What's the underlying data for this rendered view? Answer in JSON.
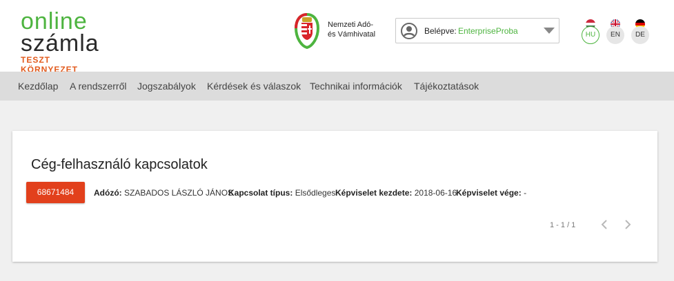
{
  "header": {
    "logo": {
      "line1": "online",
      "line2": "számla",
      "tagline": "TESZT KÖRNYEZET"
    },
    "nav_logo": {
      "line1": "Nemzeti Adó-",
      "line2": "és Vámhivatal"
    },
    "login": {
      "label": "Belépve:",
      "user": "EnterpriseProba"
    },
    "languages": [
      {
        "code": "HU",
        "active": true
      },
      {
        "code": "EN",
        "active": false
      },
      {
        "code": "DE",
        "active": false
      }
    ]
  },
  "menu": {
    "items": [
      {
        "label": "Kezdőlap"
      },
      {
        "label": "A rendszerről"
      },
      {
        "label": "Jogszabályok"
      },
      {
        "label": "Kérdések és válaszok"
      },
      {
        "label": "Technikai információk"
      },
      {
        "label": "Tájékoztatások"
      }
    ]
  },
  "card": {
    "title": "Cég-felhasználó kapcsolatok",
    "tax_number": "68671484",
    "fields": {
      "taxpayer_label": "Adózó:",
      "taxpayer_value": "SZABADOS LÁSZLÓ JÁNOS",
      "type_label": "Kapcsolat típus:",
      "type_value": "Elsődleges",
      "start_label": "Képviselet kezdete:",
      "start_value": "2018-06-16",
      "end_label": "Képviselet vége:",
      "end_value": "-"
    },
    "pager": {
      "text": "1 - 1 / 1"
    }
  },
  "colors": {
    "brand_green": "#4db43f",
    "accent_orange": "#e2401c",
    "menu_bg": "#dcdcdc"
  }
}
